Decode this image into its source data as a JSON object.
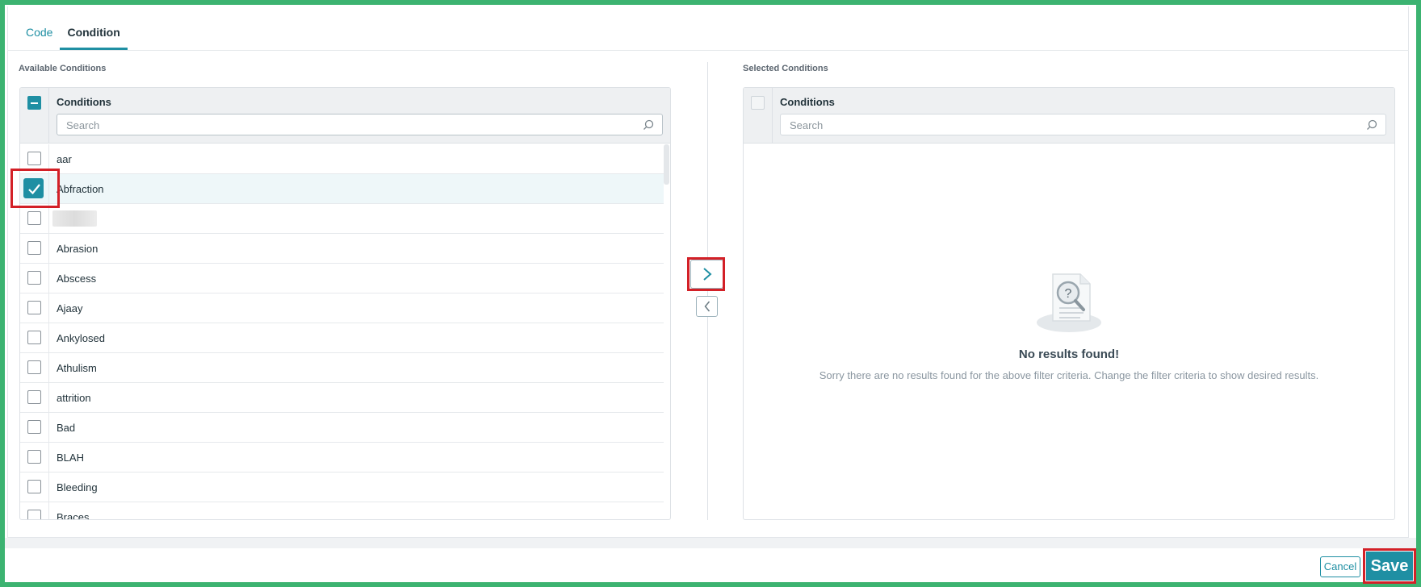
{
  "tabs": [
    {
      "label": "Code",
      "active": false
    },
    {
      "label": "Condition",
      "active": true
    }
  ],
  "available": {
    "section_label": "Available Conditions",
    "header_title": "Conditions",
    "search_placeholder": "Search",
    "header_checkbox_state": "indeterminate",
    "rows": [
      {
        "label": "aar",
        "checked": false
      },
      {
        "label": "Abfraction",
        "checked": true
      },
      {
        "label": "",
        "checked": false,
        "redacted": true
      },
      {
        "label": "Abrasion",
        "checked": false
      },
      {
        "label": "Abscess",
        "checked": false
      },
      {
        "label": "Ajaay",
        "checked": false
      },
      {
        "label": "Ankylosed",
        "checked": false
      },
      {
        "label": "Athulism",
        "checked": false
      },
      {
        "label": "attrition",
        "checked": false
      },
      {
        "label": "Bad",
        "checked": false
      },
      {
        "label": "BLAH",
        "checked": false
      },
      {
        "label": "Bleeding",
        "checked": false
      },
      {
        "label": "Braces",
        "checked": false
      }
    ]
  },
  "selected": {
    "section_label": "Selected Conditions",
    "header_title": "Conditions",
    "search_placeholder": "Search",
    "empty_title": "No results found!",
    "empty_message": "Sorry there are no results found for the above filter criteria. Change the filter criteria to show desired results."
  },
  "buttons": {
    "move_right_icon": "chevron-right-icon",
    "move_left_icon": "chevron-left-icon",
    "cancel": "Cancel",
    "save": "Save"
  },
  "colors": {
    "accent": "#1f8fa3",
    "highlight": "#d32027",
    "frame": "#3cb371"
  }
}
